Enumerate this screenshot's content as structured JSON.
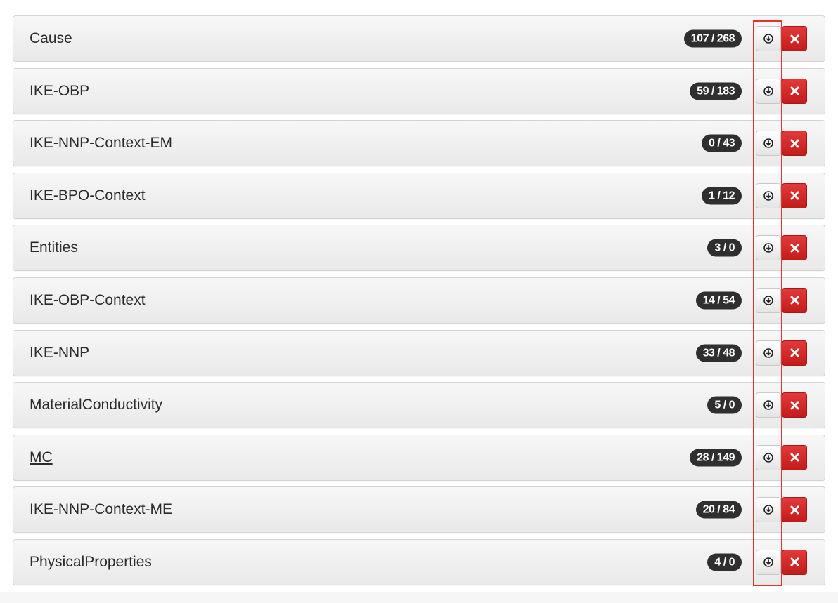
{
  "rows": [
    {
      "name": "Cause",
      "count": "107 / 268"
    },
    {
      "name": "IKE-OBP",
      "count": "59 / 183"
    },
    {
      "name": "IKE-NNP-Context-EM",
      "count": "0 / 43"
    },
    {
      "name": "IKE-BPO-Context",
      "count": "1 / 12"
    },
    {
      "name": "Entities",
      "count": "3 / 0"
    },
    {
      "name": "IKE-OBP-Context",
      "count": "14 / 54"
    },
    {
      "name": "IKE-NNP",
      "count": "33 / 48"
    },
    {
      "name": "MaterialConductivity",
      "count": "5 / 0"
    },
    {
      "name": "MC",
      "count": "28 / 149",
      "underlined": true
    },
    {
      "name": "IKE-NNP-Context-ME",
      "count": "20 / 84"
    },
    {
      "name": "PhysicalProperties",
      "count": "4 / 0"
    }
  ],
  "icons": {
    "download": "download-circle-icon",
    "delete": "close-x-icon"
  },
  "colors": {
    "badge": "#2f2f2f",
    "delete": "#d32626",
    "highlight": "#e8322c"
  }
}
